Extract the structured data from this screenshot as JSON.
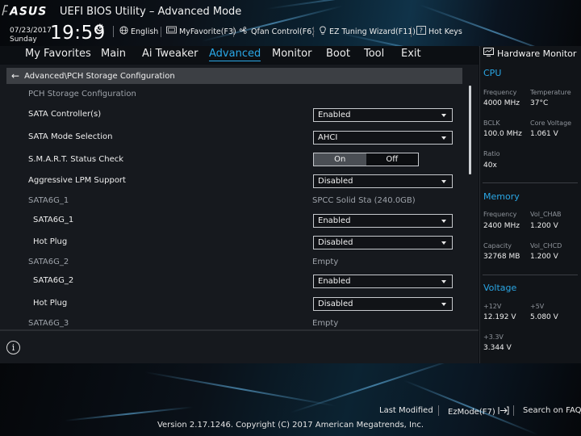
{
  "header": {
    "logo_text": "ASUS",
    "app_title": "UEFI BIOS Utility – Advanced Mode",
    "date": "07/23/2017",
    "day": "Sunday",
    "time": "19:59",
    "toolbar": [
      {
        "icon": "globe-icon",
        "label": "English"
      },
      {
        "icon": "favorite-icon",
        "label": "MyFavorite(F3)"
      },
      {
        "icon": "fan-icon",
        "label": "Qfan Control(F6)"
      },
      {
        "icon": "bulb-icon",
        "label": "EZ Tuning Wizard(F11)"
      },
      {
        "icon": "help-key-icon",
        "label": "Hot Keys"
      }
    ]
  },
  "nav": {
    "tabs": [
      "My Favorites",
      "Main",
      "Ai Tweaker",
      "Advanced",
      "Monitor",
      "Boot",
      "Tool",
      "Exit"
    ],
    "active": "Advanced"
  },
  "breadcrumb": "Advanced\\PCH Storage Configuration",
  "settings": {
    "section_title": "PCH Storage Configuration",
    "sata_controllers": {
      "label": "SATA Controller(s)",
      "value": "Enabled"
    },
    "sata_mode": {
      "label": "SATA Mode Selection",
      "value": "AHCI"
    },
    "smart": {
      "label": "S.M.A.R.T. Status Check",
      "on": "On",
      "off": "Off",
      "selected": "On"
    },
    "lpm": {
      "label": "Aggressive LPM Support",
      "value": "Disabled"
    },
    "port1": {
      "header": "SATA6G_1",
      "device": "SPCC Solid Sta (240.0GB)",
      "enable_label": "SATA6G_1",
      "enable_value": "Enabled",
      "hotplug_label": "Hot Plug",
      "hotplug_value": "Disabled"
    },
    "port2": {
      "header": "SATA6G_2",
      "device": "Empty",
      "enable_label": "SATA6G_2",
      "enable_value": "Enabled",
      "hotplug_label": "Hot Plug",
      "hotplug_value": "Disabled"
    },
    "port3": {
      "header": "SATA6G_3",
      "device": "Empty"
    }
  },
  "hardware_monitor": {
    "title": "Hardware Monitor",
    "cpu": {
      "title": "CPU",
      "frequency_label": "Frequency",
      "frequency": "4000 MHz",
      "temperature_label": "Temperature",
      "temperature": "37°C",
      "bclk_label": "BCLK",
      "bclk": "100.0 MHz",
      "core_voltage_label": "Core Voltage",
      "core_voltage": "1.061 V",
      "ratio_label": "Ratio",
      "ratio": "40x"
    },
    "memory": {
      "title": "Memory",
      "frequency_label": "Frequency",
      "frequency": "2400 MHz",
      "vol_chab_label": "Vol_CHAB",
      "vol_chab": "1.200 V",
      "capacity_label": "Capacity",
      "capacity": "32768 MB",
      "vol_chcd_label": "Vol_CHCD",
      "vol_chcd": "1.200 V"
    },
    "voltage": {
      "title": "Voltage",
      "v12_label": "+12V",
      "v12": "12.192 V",
      "v5_label": "+5V",
      "v5": "5.080 V",
      "v33_label": "+3.3V",
      "v33": "3.344 V"
    }
  },
  "footer": {
    "last_modified": "Last Modified",
    "ezmode": "EzMode(F7)",
    "search_faq": "Search on FAQ",
    "version": "Version 2.17.1246. Copyright (C) 2017 American Megatrends, Inc."
  },
  "colors": {
    "accent": "#2aa7e6",
    "content_bg": "#16191e",
    "breadcrumb_bg": "#3c3f44"
  }
}
